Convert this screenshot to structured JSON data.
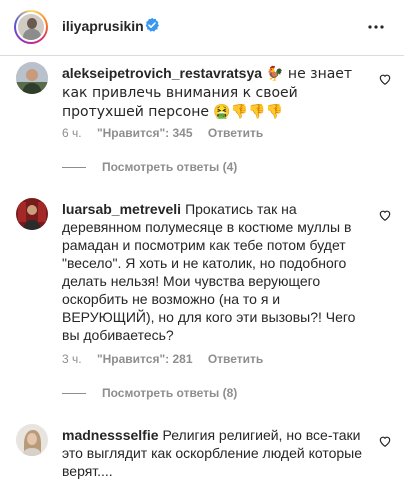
{
  "header": {
    "username": "iliyaprusikin",
    "verified_icon": "verified-badge-icon",
    "more_icon": "more-horizontal-icon"
  },
  "comments": [
    {
      "username": "alekseipetrovich_restavratsya",
      "text": "🐓 не знает как привлечь внимания к своей протухшей персоне 🤮👎👎👎",
      "time": "6 ч.",
      "likes": "\"Нравится\": 345",
      "reply": "Ответить",
      "view_replies": "Посмотреть ответы (4)"
    },
    {
      "username": "luarsab_metreveli",
      "text": "Прокатись так на деревянном полумесяце в костюме муллы в рамадан и посмотрим как тебе потом будет \"весело\". Я хоть и не католик, но подобного делать нельзя! Мои чувства верующего оскорбить не возможно (на то я и ВЕРУЮЩИЙ), но для кого эти вызовы?! Чего вы добиваетесь?",
      "time": "3 ч.",
      "likes": "\"Нравится\": 281",
      "reply": "Ответить",
      "view_replies": "Посмотреть ответы (8)"
    },
    {
      "username": "madnessselfie",
      "text": "Религия религией, но все-таки это выглядит как оскорбление людей которые верят...."
    }
  ]
}
